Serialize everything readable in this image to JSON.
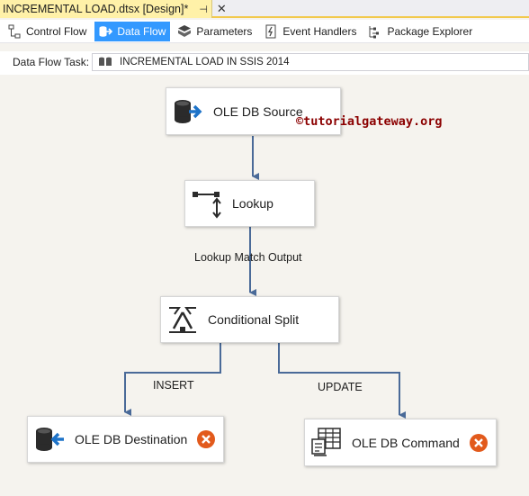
{
  "document_tab": {
    "title": "INCREMENTAL LOAD.dtsx [Design]*",
    "pin_glyph": "⊣",
    "close_glyph": "✕"
  },
  "toolbar": {
    "tabs": [
      {
        "label": "Control Flow",
        "icon": "control-flow-icon",
        "active": false
      },
      {
        "label": "Data Flow",
        "icon": "data-flow-icon",
        "active": true
      },
      {
        "label": "Parameters",
        "icon": "parameters-icon",
        "active": false
      },
      {
        "label": "Event Handlers",
        "icon": "event-handlers-icon",
        "active": false
      },
      {
        "label": "Package Explorer",
        "icon": "package-explorer-icon",
        "active": false
      }
    ]
  },
  "data_flow_task": {
    "label": "Data Flow Task:",
    "value": "INCREMENTAL LOAD IN SSIS 2014"
  },
  "canvas": {
    "nodes": {
      "source": {
        "label": "OLE DB Source",
        "icon": "ole-db-source-icon"
      },
      "lookup": {
        "label": "Lookup",
        "icon": "lookup-icon"
      },
      "split": {
        "label": "Conditional Split",
        "icon": "conditional-split-icon"
      },
      "destination": {
        "label": "OLE DB Destination",
        "icon": "ole-db-destination-icon",
        "status": "error"
      },
      "command": {
        "label": "OLE DB Command",
        "icon": "ole-db-command-icon",
        "status": "error"
      }
    },
    "paths": {
      "lookup_match": "Lookup Match Output",
      "insert": "INSERT",
      "update": "UPDATE"
    },
    "watermark": "©tutorialgateway.org"
  },
  "colors": {
    "accent": "#3399ff",
    "tab_active": "#fff1a8",
    "wire": "#4a6a98",
    "error": "#e25a1c",
    "watermark": "#8b0000"
  }
}
